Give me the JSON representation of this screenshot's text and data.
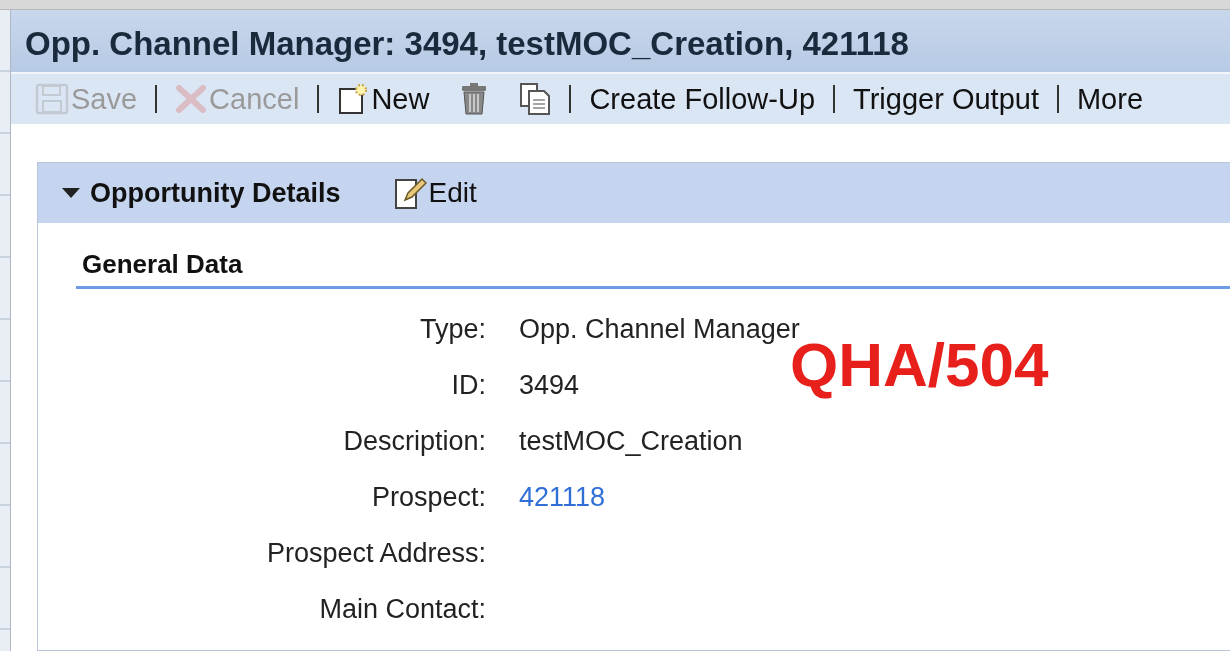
{
  "window": {
    "title": "Opp. Channel Manager: 3494, testMOC_Creation, 421118"
  },
  "toolbar": {
    "groups": [
      [
        {
          "kind": "save",
          "label": "Save",
          "disabled": true
        }
      ],
      [
        {
          "kind": "cancel",
          "label": "Cancel",
          "disabled": true
        }
      ],
      [
        {
          "kind": "new",
          "label": "New",
          "disabled": false
        },
        {
          "kind": "delete",
          "disabled": false
        },
        {
          "kind": "copy",
          "disabled": false
        }
      ],
      [
        {
          "kind": "text",
          "label": "Create Follow-Up",
          "disabled": false
        }
      ],
      [
        {
          "kind": "text",
          "label": "Trigger Output",
          "disabled": false
        }
      ],
      [
        {
          "kind": "text",
          "label": "More",
          "disabled": false
        }
      ]
    ]
  },
  "section": {
    "title": "Opportunity Details",
    "expanded": true,
    "edit_label": "Edit",
    "group": {
      "title": "General Data",
      "fields": [
        {
          "label": "Type:",
          "value": "Opp. Channel Manager",
          "link": false
        },
        {
          "label": "ID:",
          "value": "3494",
          "link": false
        },
        {
          "label": "Description:",
          "value": "testMOC_Creation",
          "link": false
        },
        {
          "label": "Prospect:",
          "value": "421118",
          "link": true
        },
        {
          "label": "Prospect Address:"
        },
        {
          "label": "Main Contact:"
        }
      ]
    }
  },
  "annotation": {
    "text": "QHA/504"
  }
}
